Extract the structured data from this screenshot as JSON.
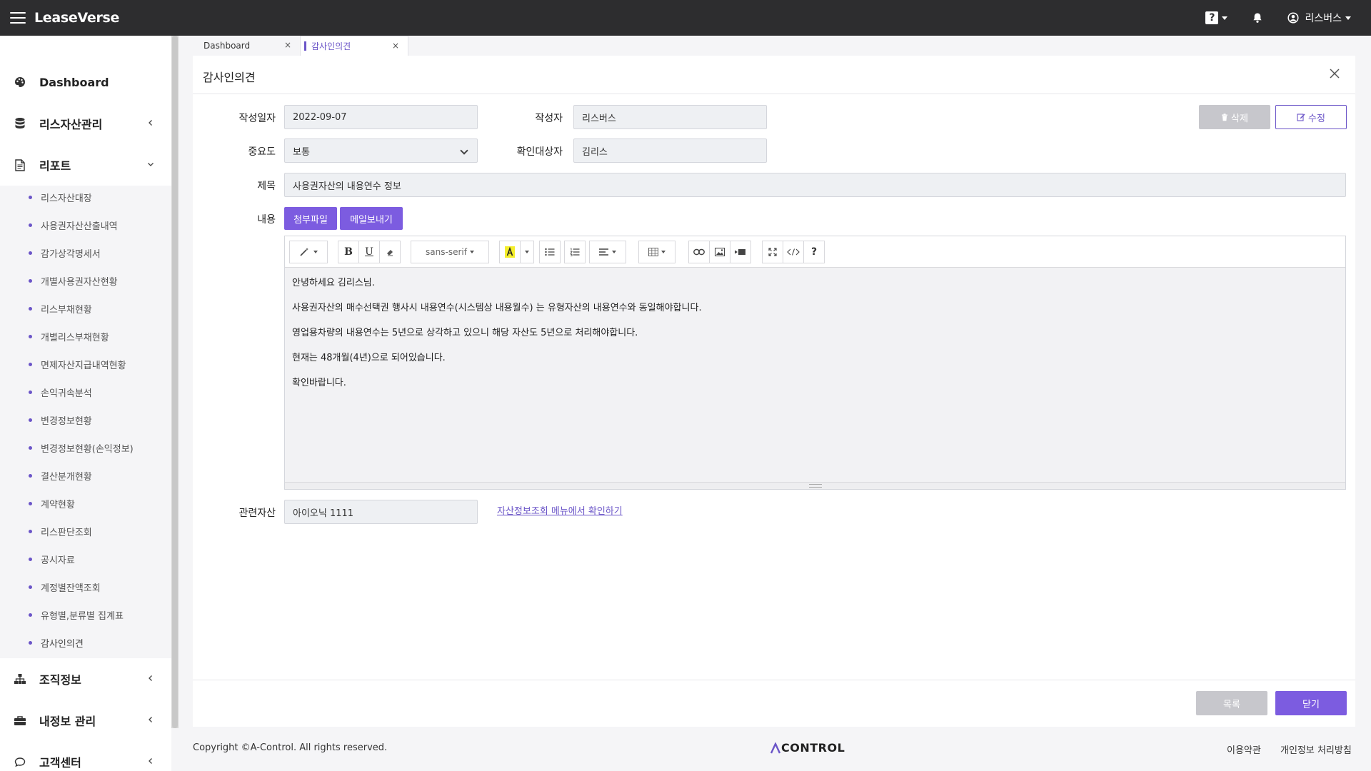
{
  "app": {
    "brand": "LeaseVerse",
    "help_glyph": "?",
    "user_name": "리스버스"
  },
  "sidebar": {
    "groups": [
      {
        "label": "Dashboard",
        "icon": "palette-icon"
      },
      {
        "label": "리스자산관리",
        "icon": "database-icon"
      },
      {
        "label": "리포트",
        "icon": "document-icon"
      },
      {
        "label": "조직정보",
        "icon": "org-chart-icon"
      },
      {
        "label": "내정보 관리",
        "icon": "briefcase-icon"
      },
      {
        "label": "고객센터",
        "icon": "chat-icon"
      }
    ],
    "report_items": [
      "리스자산대장",
      "사용권자산산출내역",
      "감가상각명세서",
      "개별사용권자산현황",
      "리스부채현황",
      "개별리스부채현황",
      "면제자산지급내역현황",
      "손익귀속분석",
      "변경정보현황",
      "변경정보현황(손익정보)",
      "결산분개현황",
      "계약현황",
      "리스판단조회",
      "공시자료",
      "계정별잔액조회",
      "유형별,분류별 집계표",
      "감사인의견"
    ]
  },
  "tabs": [
    {
      "label": "Dashboard",
      "close": "×"
    },
    {
      "label": "감사인의견",
      "close": "×"
    }
  ],
  "panel": {
    "title": "감사인의견",
    "labels": {
      "date": "작성일자",
      "author": "작성자",
      "importance": "중요도",
      "confirm_target": "확인대상자",
      "subject": "제목",
      "content": "내용",
      "related_asset": "관련자산"
    },
    "values": {
      "date": "2022-09-07",
      "author": "리스버스",
      "importance": "보통",
      "confirm_target": "김리스",
      "subject": "사용권자산의 내용연수 정보",
      "related_asset": "아이오닉 1111"
    },
    "buttons": {
      "delete": "삭제",
      "edit": "수정",
      "attach": "첨부파일",
      "send_mail": "메일보내기",
      "list": "목록",
      "close": "닫기"
    },
    "link": "자산정보조회 메뉴에서 확인하기",
    "editor": {
      "font_name": "sans-serif",
      "paragraphs": [
        "안녕하세요 김리스님.",
        "사용권자산의 매수선택권 행사시 내용연수(시스템상 내용월수) 는 유형자산의 내용연수와 동일해야합니다.",
        "영업용차량의 내용연수는 5년으로 상각하고 있으니 해당 자산도 5년으로 처리해야합니다.",
        "현재는 48개월(4년)으로 되어있습니다.",
        "확인바랍니다."
      ]
    }
  },
  "footer": {
    "copyright": "Copyright ©A-Control. All rights reserved.",
    "logo": "CONTROL",
    "terms": "이용약관",
    "privacy": "개인정보 처리방침"
  },
  "colors": {
    "accent": "#7c5ce0",
    "topbar": "#2d2d2f"
  }
}
